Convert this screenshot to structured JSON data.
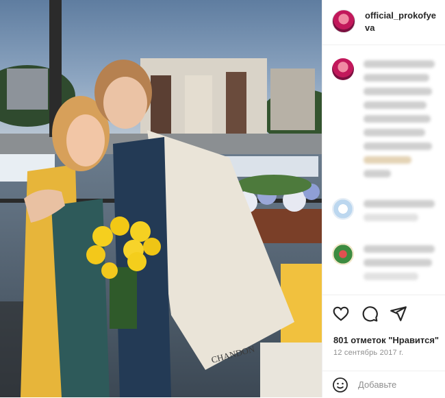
{
  "post": {
    "username": "official_prokofyeva",
    "likes_text": "801 отметок \"Нравится\"",
    "date": "12 сентябрь 2017 г.",
    "comment_placeholder": "Добавьте"
  },
  "photo": {
    "sign_text": "CHANDON",
    "towel_text": "CHANDON",
    "description": "Two people embracing on a riverside terrace with yellow flowers"
  },
  "icons": [
    "heart-icon",
    "comment-icon",
    "share-icon",
    "emoji-icon"
  ]
}
